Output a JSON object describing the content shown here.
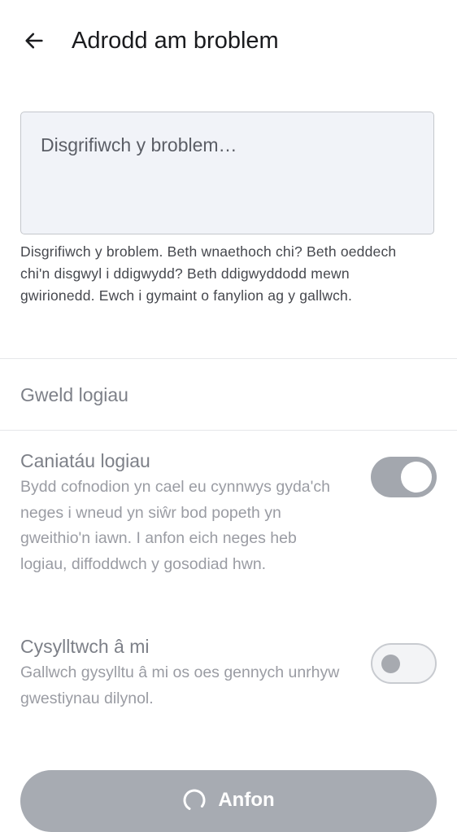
{
  "appbar": {
    "title": "Adrodd am broblem",
    "back_icon": "arrow-left-icon"
  },
  "description": {
    "placeholder": "Disgrifiwch y broblem…",
    "value": "",
    "helper": "Disgrifiwch y broblem. Beth wnaethoch chi? Beth oeddech chi'n disgwyl i ddigwydd? Beth ddigwyddodd mewn gwirionedd. Ewch i gymaint o fanylion ag y gallwch."
  },
  "view_logs": {
    "label": "Gweld logiau"
  },
  "settings": [
    {
      "title": "Caniatáu logiau",
      "subtitle": "Bydd cofnodion yn cael eu cynnwys gyda'ch neges i wneud yn siŵr bod popeth yn gweithio'n iawn. I anfon eich neges heb logiau, diffoddwch y gosodiad hwn.",
      "enabled": true
    },
    {
      "title": "Cysylltwch â mi",
      "subtitle": "Gallwch gysylltu â mi os oes gennych unrhyw gwestiynau dilynol.",
      "enabled": false
    }
  ],
  "send": {
    "label": "Anfon",
    "loading": true,
    "icon": "loading-spinner-icon"
  },
  "colors": {
    "surface": "#f1f3f8",
    "disabled_button": "#a7abb2",
    "switch_on_track": "#a3a7ae"
  }
}
